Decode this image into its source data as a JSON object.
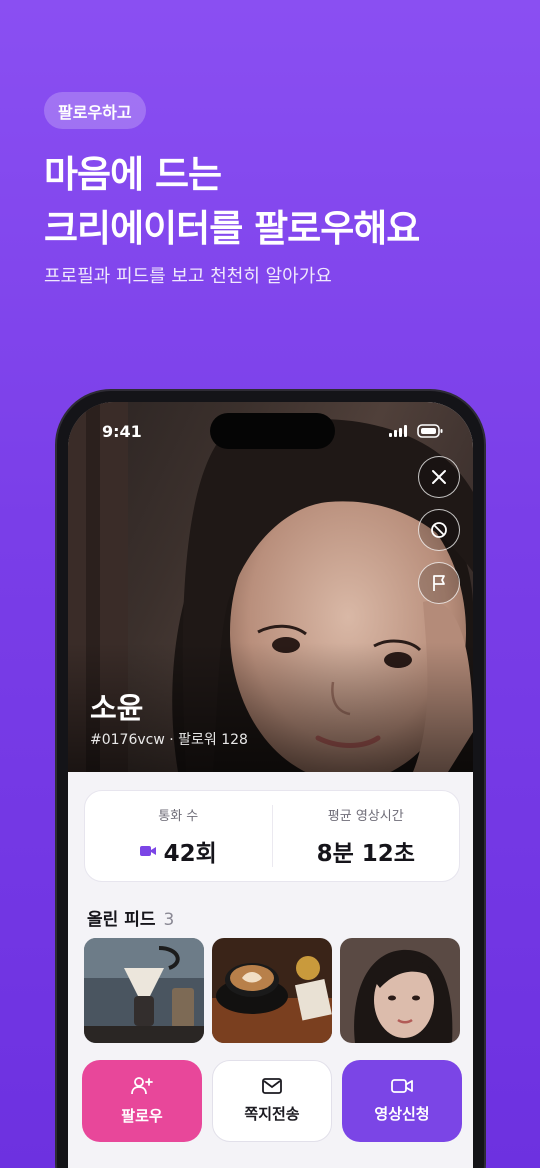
{
  "promo": {
    "tag": "팔로우하고",
    "headline_line1": "마음에 드는",
    "headline_line2": "크리에이터를 팔로우해요",
    "subhead": "프로필과 피드를 보고 천천히 알아가요"
  },
  "status_bar": {
    "time": "9:41"
  },
  "profile": {
    "name": "소윤",
    "meta": "#0176vcw · 팔로워 128"
  },
  "stats": {
    "calls_label": "통화 수",
    "calls_value": "42회",
    "avg_label": "평균 영상시간",
    "avg_value": "8분 12초"
  },
  "feed": {
    "title": "올린 피드",
    "count": "3"
  },
  "actions": {
    "follow": "팔로우",
    "message": "쪽지전송",
    "video": "영상신청"
  },
  "icons": [
    "close-icon",
    "block-icon",
    "flag-icon",
    "video-camera-icon",
    "person-plus-icon",
    "envelope-icon",
    "signal-icon",
    "battery-icon"
  ],
  "colors": {
    "background": "#7a3ee8",
    "follow_button": "#e8479a",
    "video_button": "#7b45e6",
    "accent": "#7b45e6"
  }
}
